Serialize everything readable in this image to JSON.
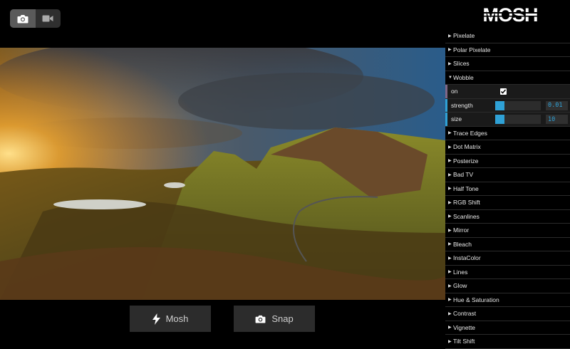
{
  "app": {
    "logo_text": "MOSH"
  },
  "mode_toggle": {
    "photo_icon": "camera-icon",
    "video_icon": "video-camera-icon",
    "active": "photo"
  },
  "actions": {
    "mosh_label": "Mosh",
    "mosh_icon": "lightning-icon",
    "snap_label": "Snap",
    "snap_icon": "camera-icon"
  },
  "panel": {
    "effects_before": [
      "Pixelate",
      "Polar Pixelate",
      "Slices"
    ],
    "open_effect": {
      "label": "Wobble",
      "params": {
        "on": {
          "label": "on",
          "checked": true,
          "accent": "#806787"
        },
        "strength": {
          "label": "strength",
          "value": "0.01",
          "fraction": 0.01,
          "accent": "#2fa1d6"
        },
        "size": {
          "label": "size",
          "value": "10",
          "fraction": 0.1,
          "accent": "#2fa1d6"
        }
      }
    },
    "effects_after": [
      "Trace Edges",
      "Dot Matrix",
      "Posterize",
      "Bad TV",
      "Half Tone",
      "RGB Shift",
      "Scanlines",
      "Mirror",
      "Bleach",
      "InstaColor",
      "Lines",
      "Glow",
      "Hue & Saturation",
      "Contrast",
      "Vignette",
      "Tilt Shift"
    ]
  },
  "colors": {
    "slider": "#2fa1d6",
    "panel_bg": "#1a1a1a",
    "row_bg": "#000000"
  }
}
